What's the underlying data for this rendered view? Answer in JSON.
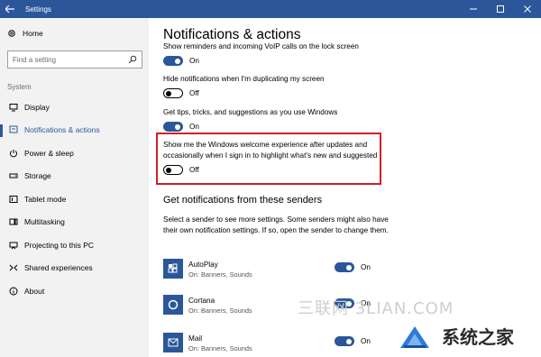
{
  "window": {
    "title": "Settings"
  },
  "sidebar": {
    "home_label": "Home",
    "search_placeholder": "Find a setting",
    "section_label": "System",
    "items": [
      {
        "label": "Display",
        "icon": "display-icon"
      },
      {
        "label": "Notifications & actions",
        "icon": "notifications-icon",
        "active": true
      },
      {
        "label": "Power & sleep",
        "icon": "power-icon"
      },
      {
        "label": "Storage",
        "icon": "storage-icon"
      },
      {
        "label": "Tablet mode",
        "icon": "tablet-mode-icon"
      },
      {
        "label": "Multitasking",
        "icon": "multitasking-icon"
      },
      {
        "label": "Projecting to this PC",
        "icon": "projecting-icon"
      },
      {
        "label": "Shared experiences",
        "icon": "shared-experiences-icon"
      },
      {
        "label": "About",
        "icon": "about-icon"
      }
    ]
  },
  "main": {
    "title": "Notifications & actions",
    "settings": [
      {
        "label": "Show reminders and incoming VoIP calls on the lock screen",
        "state": "On"
      },
      {
        "label": "Hide notifications when I'm duplicating my screen",
        "state": "Off"
      },
      {
        "label": "Get tips, tricks, and suggestions as you use Windows",
        "state": "On"
      },
      {
        "label": "Show me the Windows welcome experience after updates and occasionally when I sign in to highlight what's new and suggested",
        "label_line1": "Show me the Windows welcome experience after updates and",
        "label_line2": "occasionally when I sign in to highlight what's new and suggested",
        "state": "Off"
      }
    ],
    "senders_heading": "Get notifications from these senders",
    "senders_desc": "Select a sender to see more settings. Some senders might also have their own notification settings. If so, open the sender to change them.",
    "senders": [
      {
        "name": "AutoPlay",
        "sub": "On: Banners, Sounds",
        "state": "On",
        "icon": "autoplay-icon"
      },
      {
        "name": "Cortana",
        "sub": "On: Banners, Sounds",
        "state": "On",
        "icon": "cortana-icon"
      },
      {
        "name": "Mail",
        "sub": "On: Banners, Sounds",
        "state": "On",
        "icon": "mail-icon"
      }
    ]
  },
  "watermark": {
    "text1": "三联网 3LIAN.COM",
    "text2": "系统之家"
  },
  "colors": {
    "accent": "#2b579a",
    "highlight": "#d11f2a",
    "sidebar_bg": "#f2f2f2"
  }
}
